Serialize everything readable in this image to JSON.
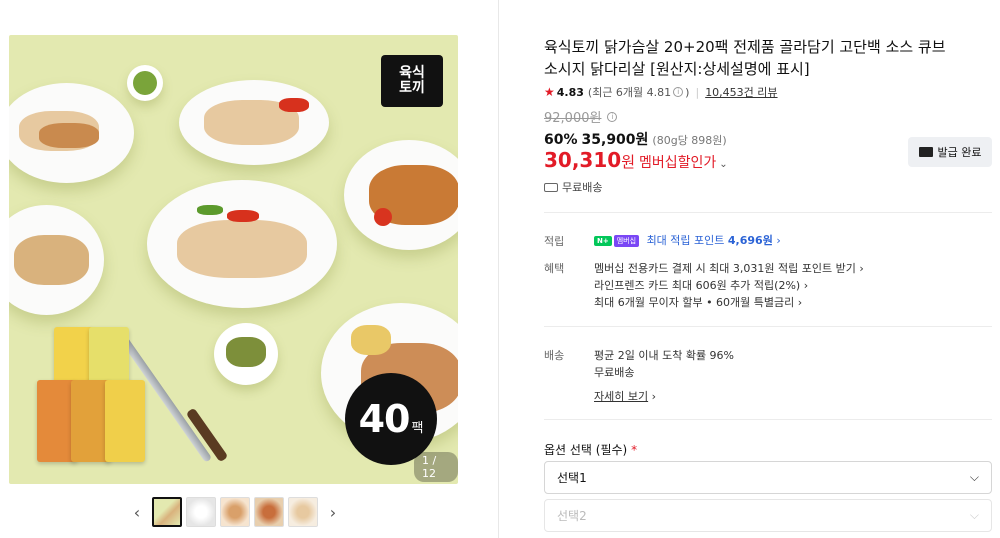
{
  "gallery": {
    "logo_text": "육식\n토끼",
    "badge_number": "40",
    "badge_unit": "팩",
    "counter": "1 / 12",
    "prev_arrow": "‹",
    "next_arrow": "›",
    "thumbnail_count": 5,
    "active_thumbnail": 1
  },
  "product": {
    "title": "육식토끼 닭가슴살 20+20팩 전제품 골라담기 고단백 소스 큐브 소시지 닭다리살 [원산지:상세설명에 표시]",
    "rating": "4.83",
    "rating_recent": "(최근 6개월 4.81",
    "rating_recent_close": ")",
    "review_count": "10,453건 리뷰",
    "original_price": "92,000원",
    "discount_rate": "60%",
    "sale_price": "35,900원",
    "unit_price": "(80g당 898원)",
    "member_price": "30,310",
    "member_won": "원",
    "member_label": "멤버십할인가",
    "coupon_button": "발급 완료",
    "shipping": "무료배송"
  },
  "benefits": {
    "points_label": "적립",
    "npay_badge": "N+",
    "npay_badge2": "멤버십",
    "points_text_prefix": "최대 적립 포인트",
    "points_amount": "4,696원",
    "benefit_label": "혜택",
    "benefit_line1": "멤버십 전용카드 결제 시 최대 3,031원 적립 포인트 받기",
    "benefit_line2": "라인프렌즈 카드 최대 606원 추가 적립(2%)",
    "benefit_line3": "최대 6개월 무이자 할부 • 60개월 특별금리"
  },
  "delivery": {
    "label": "배송",
    "line1": "평균 2일 이내 도착 확률 96%",
    "line2": "무료배송",
    "more": "자세히 보기"
  },
  "options": {
    "title": "옵션 선택 (필수)",
    "required_mark": "*",
    "select1": "선택1",
    "select2": "선택2"
  },
  "colors": {
    "accent_red": "#e21b27",
    "point_blue": "#2b63d6",
    "npay_green": "#03c75a",
    "image_bg": "#e3e9b0"
  }
}
